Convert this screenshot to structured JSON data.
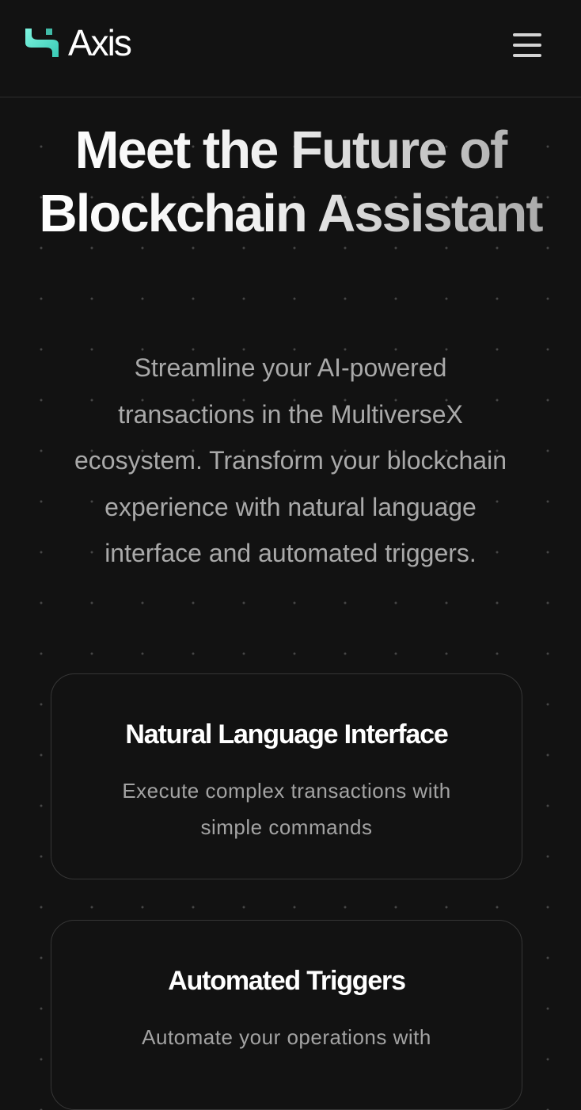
{
  "header": {
    "logo_text": "Axis",
    "menu_icon": "hamburger-menu-icon",
    "logo_accent_color": "#5eead4"
  },
  "hero": {
    "title": "Meet the Future of Blockchain Assistant",
    "subtitle": "Streamline your AI-powered transactions in the MultiverseX ecosystem. Transform your blockchain experience with natural language interface and automated triggers."
  },
  "features": [
    {
      "title": "Natural Language Interface",
      "description": "Execute complex transactions with simple commands"
    },
    {
      "title": "Automated Triggers",
      "description": "Automate your operations with"
    }
  ]
}
